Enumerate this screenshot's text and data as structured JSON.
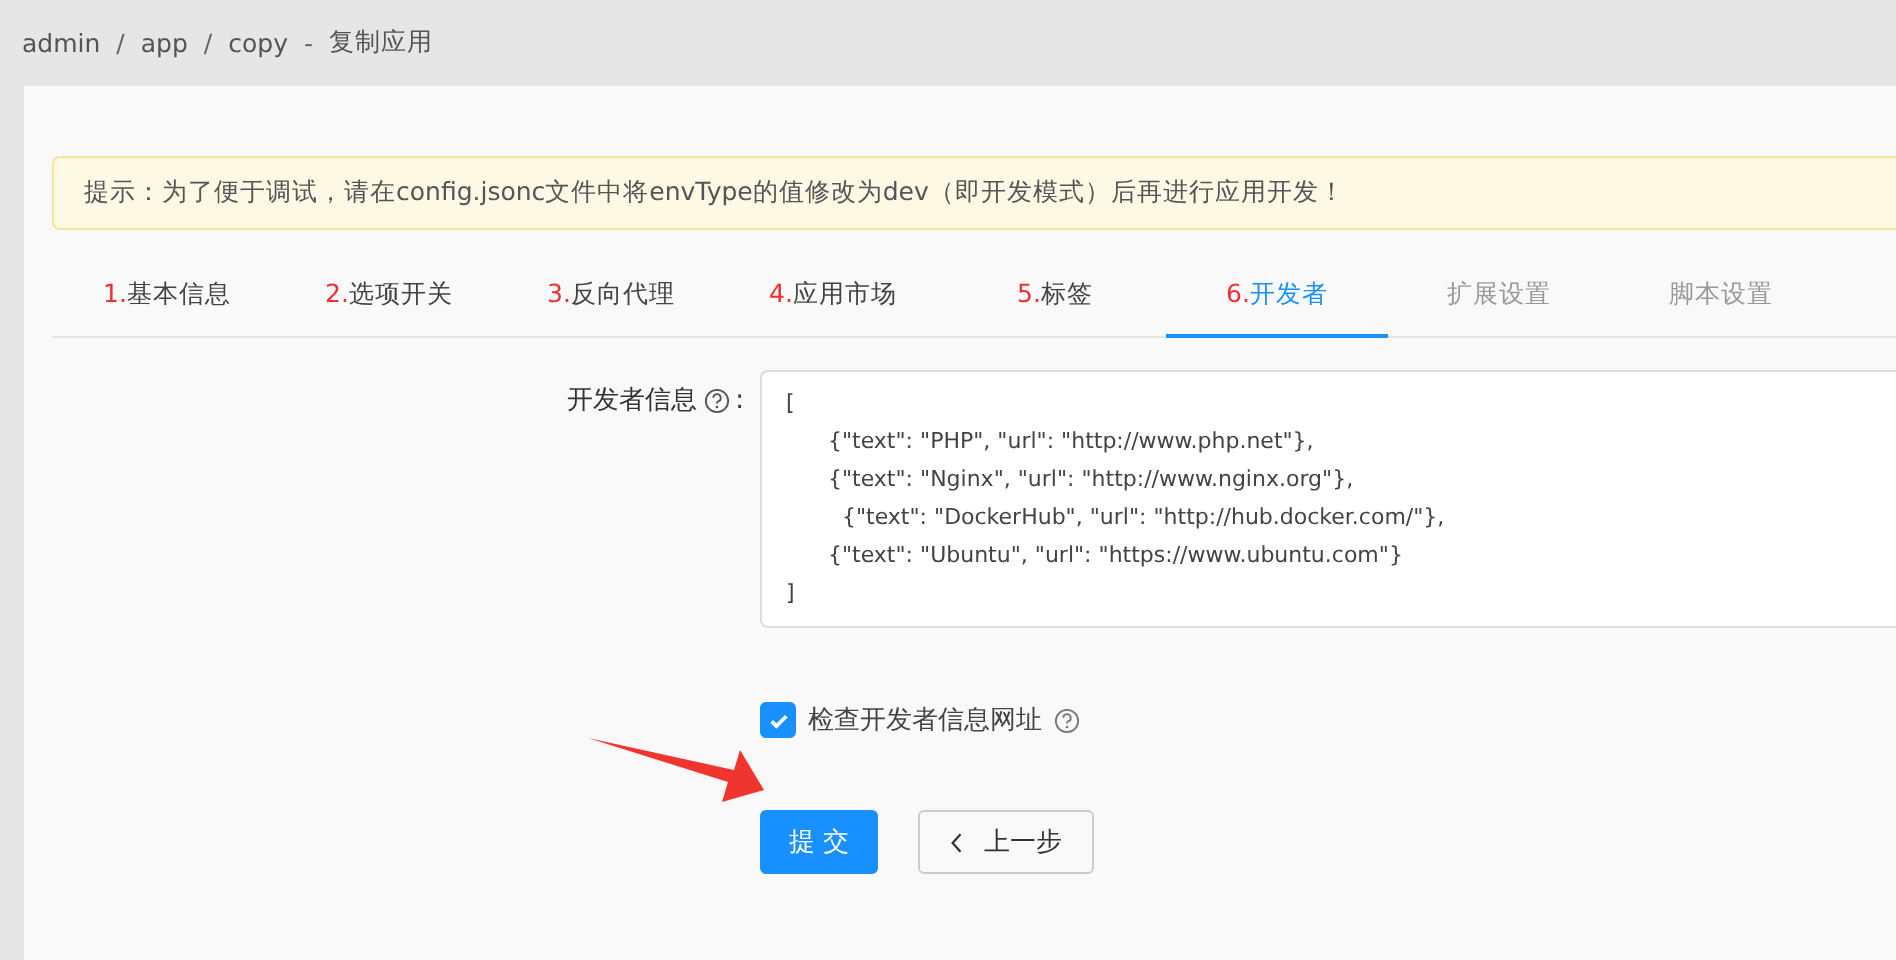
{
  "breadcrumb": [
    "admin",
    "app",
    "copy"
  ],
  "breadcrumb_separator": "/",
  "title_separator": "-",
  "breadcrumb_title": "复制应用",
  "alert": "提示：为了便于调试，请在config.jsonc文件中将envType的值修改为dev（即开发模式）后再进行应用开发！",
  "tabs": [
    {
      "number": "1.",
      "label": "基本信息",
      "selected": false,
      "disabled": false
    },
    {
      "number": "2.",
      "label": "选项开关",
      "selected": false,
      "disabled": false
    },
    {
      "number": "3.",
      "label": "反向代理",
      "selected": false,
      "disabled": false
    },
    {
      "number": "4.",
      "label": "应用市场",
      "selected": false,
      "disabled": false
    },
    {
      "number": "5.",
      "label": "标签",
      "selected": false,
      "disabled": false
    },
    {
      "number": "6.",
      "label": "开发者",
      "selected": true,
      "disabled": false
    },
    {
      "label": "扩展设置",
      "selected": false,
      "disabled": true
    },
    {
      "label": "脚本设置",
      "selected": false,
      "disabled": true
    }
  ],
  "developer_field": {
    "label": "开发者信息",
    "label_suffix": ":",
    "value": "[\n      {\"text\": \"PHP\", \"url\": \"http://www.php.net\"},\n      {\"text\": \"Nginx\", \"url\": \"http://www.nginx.org\"},\n        {\"text\": \"DockerHub\", \"url\": \"http://hub.docker.com/\"},\n      {\"text\": \"Ubuntu\", \"url\": \"https://www.ubuntu.com\"}\n]"
  },
  "check_urls": {
    "label": "检查开发者信息网址",
    "checked": true
  },
  "buttons": {
    "submit": "提 交",
    "back": "上一步"
  }
}
